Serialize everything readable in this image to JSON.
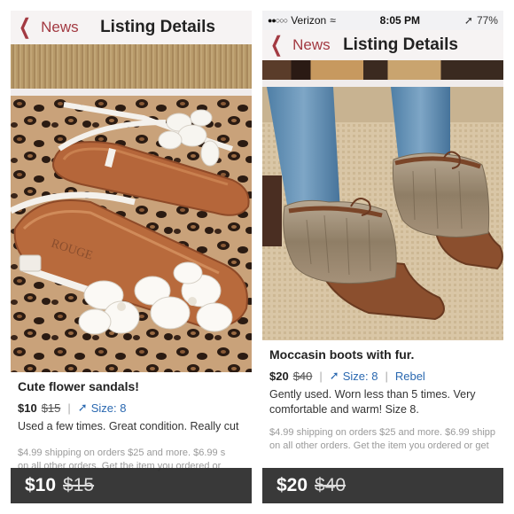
{
  "left": {
    "nav": {
      "back_label": "News",
      "title": "Listing Details"
    },
    "listing": {
      "title": "Cute flower sandals!",
      "price": "$10",
      "original_price": "$15",
      "size": "Size: 8",
      "description": "Used a few times. Great condition. Really cut",
      "shipping_line1": "$4.99 shipping on orders $25 and more. $6.99 s",
      "shipping_line2": "on all other orders. Get the item you ordered or"
    },
    "price_bar": {
      "price": "$10",
      "original_price": "$15"
    },
    "photo_brand_text": "ROUGE"
  },
  "right": {
    "status": {
      "carrier": "Verizon",
      "time": "8:05 PM",
      "battery": "77%"
    },
    "nav": {
      "back_label": "News",
      "title": "Listing Details"
    },
    "listing": {
      "title": "Moccasin boots with fur.",
      "price": "$20",
      "original_price": "$40",
      "size": "Size: 8",
      "brand": "Rebel",
      "description": "Gently used. Worn less than 5 times. Very comfortable and warm! Size 8.",
      "shipping_line1": "$4.99 shipping on orders $25 and more. $6.99 shipp",
      "shipping_line2": "on all other orders. Get the item you ordered or get"
    },
    "price_bar": {
      "price": "$20",
      "original_price": "$40"
    }
  },
  "colors": {
    "accent": "#a33a42",
    "link": "#2a68b0",
    "bar": "#282828"
  }
}
